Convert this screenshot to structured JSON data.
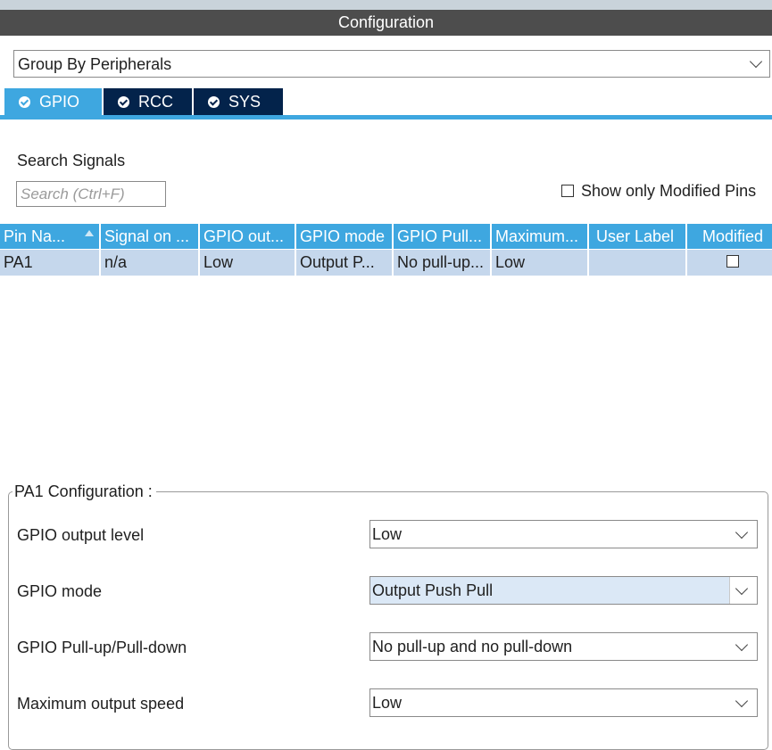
{
  "window": {
    "title": "Configuration"
  },
  "group_by": {
    "value": "Group By Peripherals"
  },
  "tabs": [
    {
      "label": "GPIO",
      "active": true
    },
    {
      "label": "RCC",
      "active": false
    },
    {
      "label": "SYS",
      "active": false
    }
  ],
  "search": {
    "label": "Search Signals",
    "placeholder": "Search (Ctrl+F)"
  },
  "filter": {
    "label": "Show only Modified Pins",
    "checked": false
  },
  "table": {
    "headers": [
      "Pin Na...",
      "Signal on ...",
      "GPIO out...",
      "GPIO mode",
      "GPIO Pull...",
      "Maximum...",
      "User Label",
      "Modified"
    ],
    "rows": [
      {
        "cells": [
          "PA1",
          "n/a",
          "Low",
          "Output P...",
          "No pull-up...",
          "Low",
          ""
        ],
        "modified": false
      }
    ]
  },
  "config": {
    "title": "PA1 Configuration :",
    "fields": [
      {
        "label": "GPIO output level",
        "value": "Low"
      },
      {
        "label": "GPIO mode",
        "value": "Output Push Pull"
      },
      {
        "label": "GPIO Pull-up/Pull-down",
        "value": "No pull-up and no pull-down"
      },
      {
        "label": "Maximum output speed",
        "value": "Low"
      }
    ]
  },
  "colors": {
    "accent": "#3ea7e0",
    "tab_inactive": "#03234b",
    "titlebar": "#4d4d4d",
    "row_selected": "#c5d7ec"
  }
}
